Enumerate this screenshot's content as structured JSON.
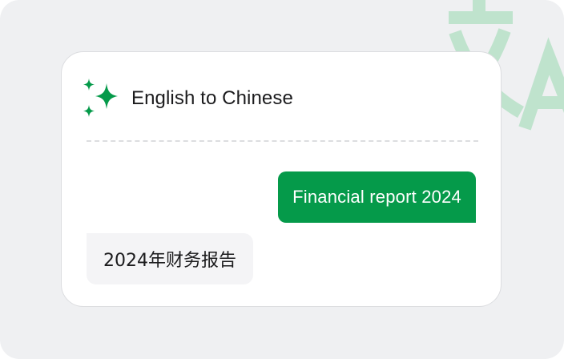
{
  "colors": {
    "accent": "#059a4a",
    "background": "#eff0f2",
    "card": "#ffffff",
    "watermark": "#bfe3cd",
    "text": "#1b1b1d",
    "bot_bubble": "#f4f4f6"
  },
  "background_icon": {
    "name": "translate-icon"
  },
  "header": {
    "icon": "sparkle-icon",
    "title": "English to Chinese"
  },
  "messages": [
    {
      "role": "user",
      "text": "Financial report 2024"
    },
    {
      "role": "assistant",
      "text": "2024年财务报告"
    }
  ]
}
